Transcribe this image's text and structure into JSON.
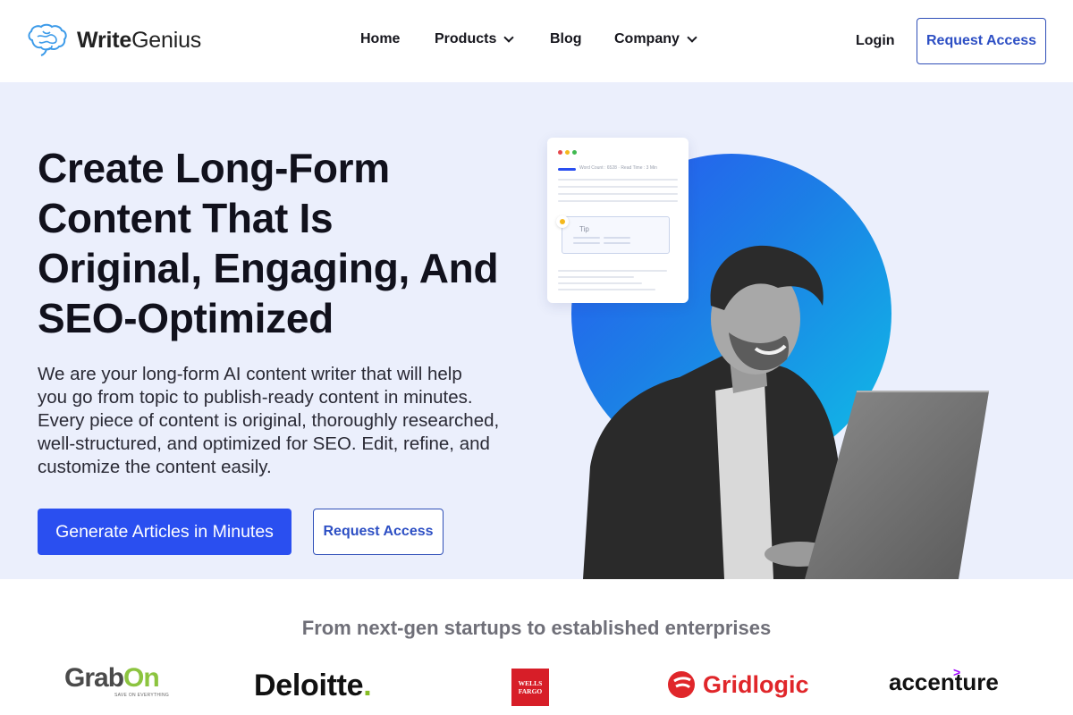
{
  "brand": {
    "name_bold": "Write",
    "name_regular": "Genius",
    "logo_icon": "brain-icon",
    "accent_color": "#2a4ff0"
  },
  "nav": {
    "items": [
      {
        "label": "Home",
        "has_dropdown": false
      },
      {
        "label": "Products",
        "has_dropdown": true
      },
      {
        "label": "Blog",
        "has_dropdown": false
      },
      {
        "label": "Company",
        "has_dropdown": true
      }
    ],
    "login_label": "Login",
    "request_access_label": "Request Access"
  },
  "hero": {
    "headline_lines": [
      "Create Long-Form",
      "Content That Is",
      "Original, Engaging, And",
      "SEO-Optimized"
    ],
    "subtext_lines": [
      "We are your long-form AI content writer that will help",
      "you go from topic to publish-ready content in minutes.",
      "Every piece of content is original, thoroughly researched,",
      "well-structured, and optimized for SEO. Edit, refine, and",
      "customize the content easily."
    ],
    "primary_cta": "Generate Articles in Minutes",
    "secondary_cta": "Request Access",
    "mock_card": {
      "meta": "Word Count : 6528  ·  Read Time : 3 Min",
      "tip_label": "Tip"
    }
  },
  "clients": {
    "tagline": "From next-gen startups to established enterprises",
    "logos": [
      {
        "name": "GrabOn",
        "part1": "Grab",
        "part2": "On",
        "sub": "SAVE ON EVERYTHING"
      },
      {
        "name": "Deloitte",
        "text": "Deloitte",
        "dot": "."
      },
      {
        "name": "Wells Fargo",
        "line1": "WELLS",
        "line2": "FARGO"
      },
      {
        "name": "Gridlogic",
        "text": "Gridlogic"
      },
      {
        "name": "accenture",
        "text": "accenture",
        "mark": ">"
      }
    ]
  }
}
